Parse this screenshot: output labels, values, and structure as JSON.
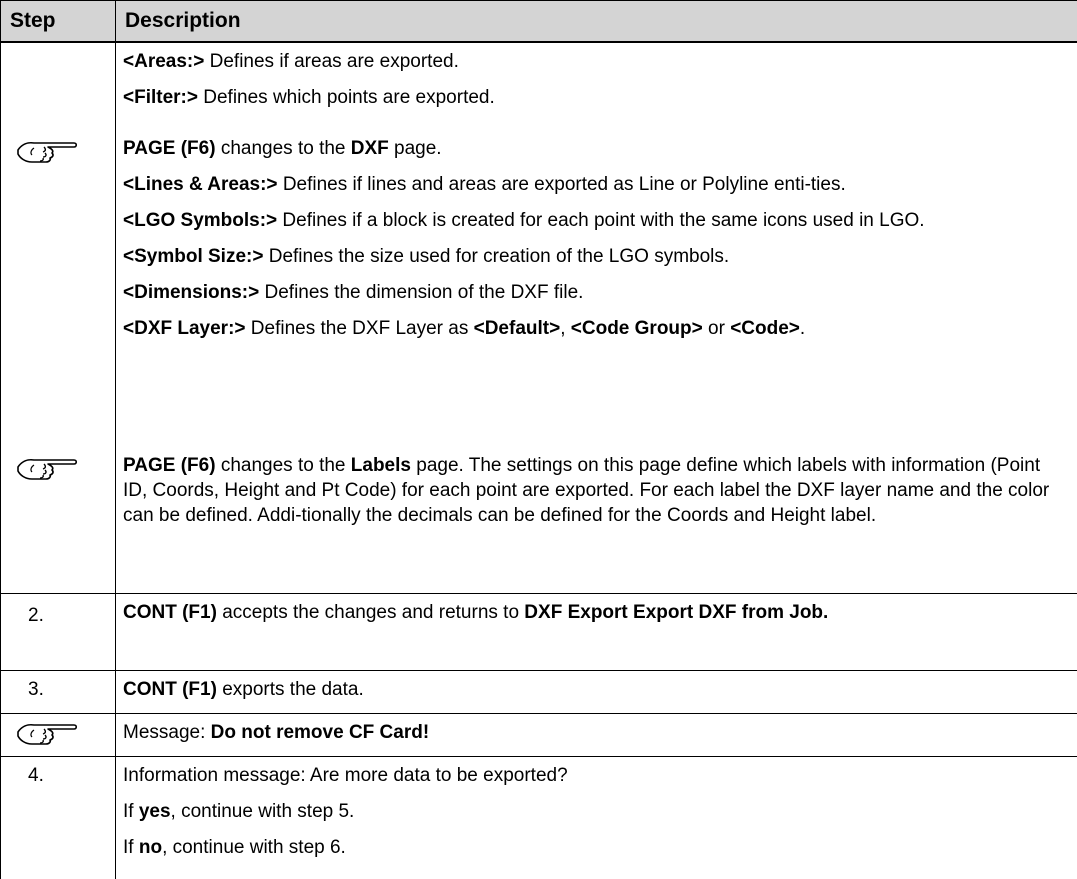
{
  "header": {
    "step": "Step",
    "description": "Description"
  },
  "rows": [
    {
      "step": "",
      "lines": [
        [
          {
            "b": "<Areas:>"
          },
          {
            "t": " Defines if areas are exported."
          }
        ],
        [
          {
            "b": "<Filter:>"
          },
          {
            "t": " Defines which points are exported."
          }
        ]
      ]
    },
    {
      "step_icon": "hand-pointer-icon",
      "lines": [
        [
          {
            "b": "PAGE (F6)"
          },
          {
            "t": " changes to the "
          },
          {
            "b": "DXF"
          },
          {
            "t": " page."
          }
        ],
        [
          {
            "b": "<Lines & Areas:>"
          },
          {
            "t": " Defines if lines and areas are exported as Line or Polyline enti-ties."
          }
        ],
        [
          {
            "b": "<LGO Symbols:>"
          },
          {
            "t": " Defines if a block is created for each point with the same icons used in LGO."
          }
        ],
        [
          {
            "b": "<Symbol Size:>"
          },
          {
            "t": " Defines the size used for creation of the LGO symbols."
          }
        ],
        [
          {
            "b": "<Dimensions:>"
          },
          {
            "t": " Defines the dimension of the DXF file."
          }
        ],
        [
          {
            "b": "<DXF Layer:>"
          },
          {
            "t": " Defines the DXF Layer as "
          },
          {
            "b": "<Default>"
          },
          {
            "t": ", "
          },
          {
            "b": "<Code Group>"
          },
          {
            "t": " or "
          },
          {
            "b": "<Code>"
          },
          {
            "t": "."
          }
        ]
      ]
    },
    {
      "step_icon": "hand-pointer-icon",
      "lines": [
        [
          {
            "b": "PAGE (F6)"
          },
          {
            "t": " changes to the "
          },
          {
            "b": "Labels"
          },
          {
            "t": " page. The settings on this page define which labels with information (Point ID, Coords, Height and Pt Code) for each point are exported. For each label the DXF layer name and the color can be defined. Addi-tionally the decimals can be defined for the Coords and Height label."
          }
        ]
      ]
    },
    {
      "step": "2.",
      "lines": [
        [
          {
            "b": "CONT (F1)"
          },
          {
            "t": " accepts the changes and returns to "
          },
          {
            "b": "DXF Export Export DXF from Job."
          }
        ]
      ]
    },
    {
      "step": "3.",
      "lines": [
        [
          {
            "b": "CONT (F1)"
          },
          {
            "t": " exports the data."
          }
        ]
      ]
    },
    {
      "step_icon": "hand-pointer-icon",
      "lines": [
        [
          {
            "t": "Message: "
          },
          {
            "b": "Do not remove CF Card!"
          }
        ]
      ]
    },
    {
      "step": "4.",
      "lines": [
        [
          {
            "t": "Information message: Are more data to be exported?"
          }
        ],
        [
          {
            "t": "If "
          },
          {
            "b": "yes"
          },
          {
            "t": ", continue with step 5."
          }
        ],
        [
          {
            "t": "If "
          },
          {
            "b": "no"
          },
          {
            "t": ", continue with step 6."
          }
        ]
      ]
    }
  ]
}
